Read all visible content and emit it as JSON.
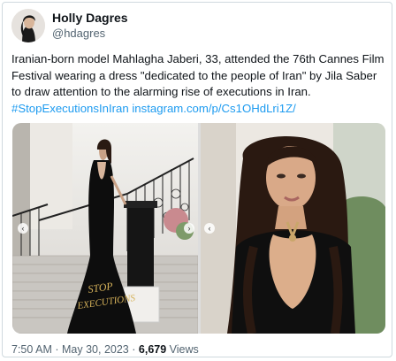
{
  "user": {
    "display_name": "Holly Dagres",
    "handle": "@hdagres",
    "verified": true,
    "verified_color": "#1d9bf0"
  },
  "tweet": {
    "text": "Iranian-born model Mahlagha Jaberi, 33, attended the 76th Cannes Film Festival wearing a dress \"dedicated to the people of Iran\" by Jila Saber to draw attention to the alarming rise of executions in Iran.",
    "hashtag": "#StopExecutionsInIran",
    "link": "instagram.com/p/Cs1OHdLri1Z/"
  },
  "media": {
    "dress_text_line1": "STOP",
    "dress_text_line2": "EXECUTIONS",
    "nav_prev": "‹",
    "nav_next": "›"
  },
  "footer": {
    "time": "7:50 AM",
    "sep": "·",
    "date": "May 30, 2023",
    "views_count": "6,679",
    "views_label": "Views"
  },
  "colors": {
    "link": "#1d9bf0",
    "secondary_text": "#536471",
    "border": "#cfd9de"
  }
}
